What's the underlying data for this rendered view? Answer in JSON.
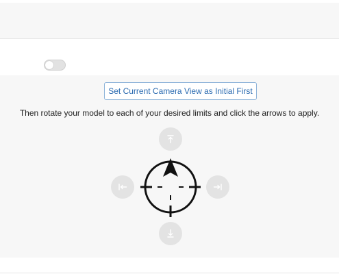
{
  "settings": {
    "toggle_on": false
  },
  "camera": {
    "set_initial_label": "Set Current Camera View as Initial First",
    "instruction": "Then rotate your model to each of your desired limits and click the arrows to apply."
  },
  "icons": {
    "limit_up": "arrow-up-to-line-icon",
    "limit_down": "arrow-down-to-line-icon",
    "limit_left": "arrow-left-to-line-icon",
    "limit_right": "arrow-right-to-line-icon",
    "compass": "compass-crosshair-icon"
  },
  "colors": {
    "button_border": "#8db3d9",
    "button_text": "#2a6ab0",
    "arrow_bg": "#e3e3e3",
    "arrow_fg": "#ffffff",
    "panel_bg": "#f7f7f7"
  }
}
